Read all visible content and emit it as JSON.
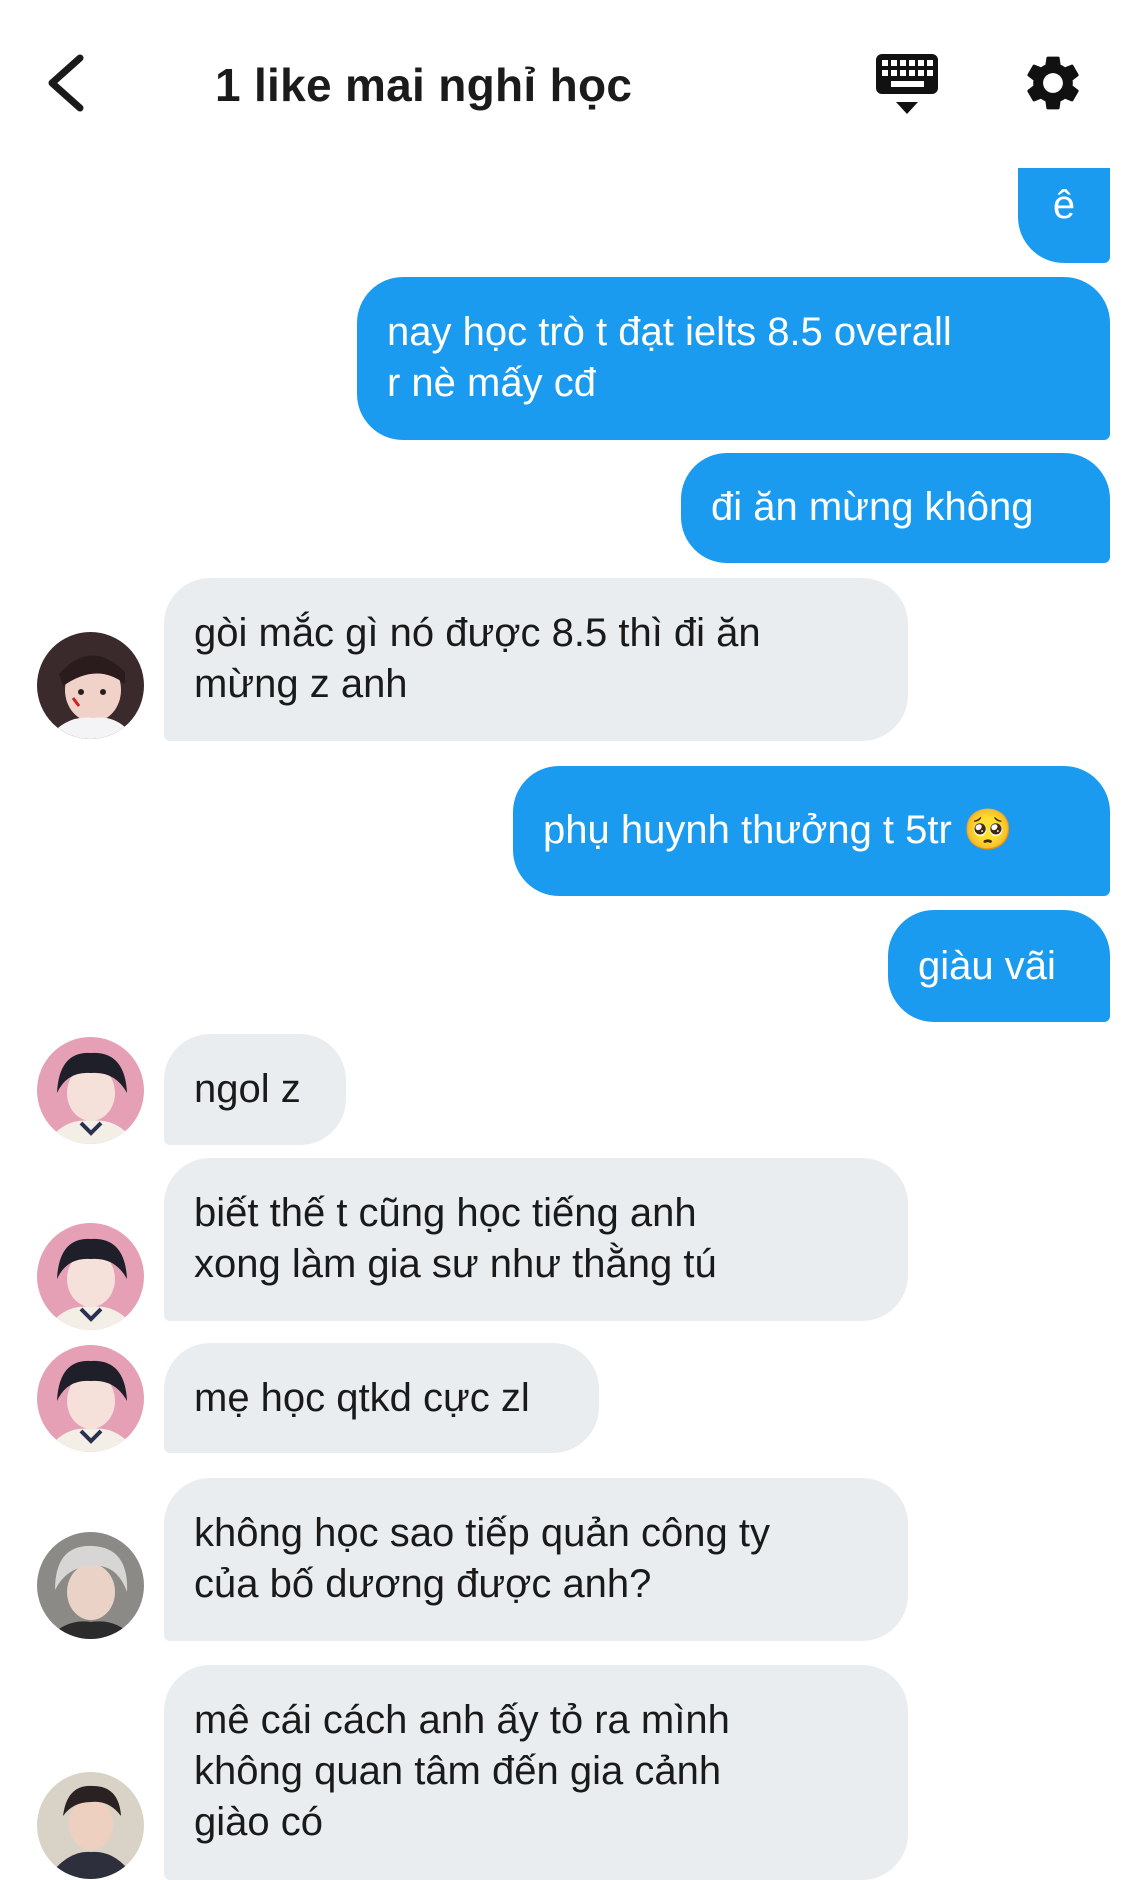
{
  "header": {
    "title": "1 like mai nghỉ học",
    "back_icon": "chevron-left-icon",
    "keyboard_icon": "keyboard-icon",
    "settings_icon": "gear-icon"
  },
  "messages": [
    {
      "id": 0,
      "direction": "out",
      "text": "ê"
    },
    {
      "id": 1,
      "direction": "out",
      "text": "nay học trò t đạt ielts  8.5 overall\nr nè mấy cđ"
    },
    {
      "id": 2,
      "direction": "out",
      "text": "đi ăn mừng không"
    },
    {
      "id": 3,
      "direction": "in",
      "avatar": "avatar-user-a",
      "text": "gòi mắc gì nó được 8.5 thì đi ăn\nmừng z anh"
    },
    {
      "id": 4,
      "direction": "out",
      "text": "phụ huynh thưởng t 5tr 🥺"
    },
    {
      "id": 5,
      "direction": "out",
      "text": "giàu vãi"
    },
    {
      "id": 6,
      "direction": "in",
      "avatar": "avatar-user-b",
      "text": "ngol z"
    },
    {
      "id": 7,
      "direction": "in",
      "avatar": "avatar-user-b",
      "text": "biết thế t cũng học tiếng anh\nxong làm gia sư như thằng tú"
    },
    {
      "id": 8,
      "direction": "in",
      "avatar": "avatar-user-b",
      "text": "mẹ học qtkd cực zl"
    },
    {
      "id": 9,
      "direction": "in",
      "avatar": "avatar-user-c",
      "text": "không học sao tiếp quản công ty\ncủa bố dương được anh?"
    },
    {
      "id": 10,
      "direction": "in",
      "avatar": "avatar-user-d",
      "text": "mê cái cách anh ấy tỏ ra mình\nkhông quan tâm đến gia cảnh\ngiào có"
    }
  ],
  "colors": {
    "outgoing_bubble": "#1b9bf0",
    "incoming_bubble": "#eaedf0",
    "outgoing_text": "#ffffff",
    "incoming_text": "#1a1a1a"
  }
}
